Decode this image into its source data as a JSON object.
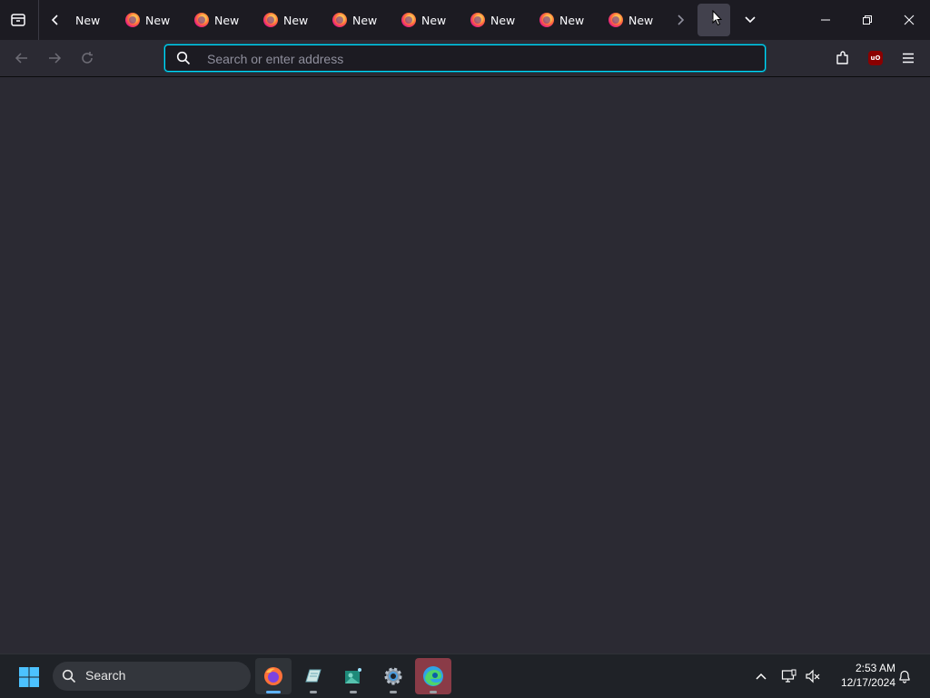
{
  "tabbar": {
    "tabs": [
      {
        "label": "New"
      },
      {
        "label": "New"
      },
      {
        "label": "New"
      },
      {
        "label": "New"
      },
      {
        "label": "New"
      },
      {
        "label": "New"
      },
      {
        "label": "New"
      },
      {
        "label": "New"
      },
      {
        "label": "New"
      }
    ],
    "new_tab_label": "-",
    "icons": {
      "tab_list": "firefox-view-icon",
      "scroll_left": "chevron-left-icon",
      "scroll_right": "chevron-right-icon",
      "all_tabs": "chevron-down-icon",
      "minimize": "minimize-icon",
      "restore": "restore-icon",
      "close": "close-icon"
    }
  },
  "navbar": {
    "address": {
      "value": "",
      "placeholder": "Search or enter address"
    },
    "extensions": [
      {
        "name": "extensions-icon"
      },
      {
        "name": "ublock-origin-icon",
        "text": "uO"
      }
    ],
    "menu_icon": "hamburger-menu-icon"
  },
  "taskbar": {
    "search_label": "Search",
    "apps": [
      {
        "name": "firefox",
        "active": true
      },
      {
        "name": "notes-app"
      },
      {
        "name": "image-app"
      },
      {
        "name": "settings"
      },
      {
        "name": "edge"
      }
    ],
    "tray": {
      "time": "2:53 AM",
      "date": "12/17/2024"
    }
  },
  "colors": {
    "accent": "#00ddff",
    "tabbar_bg": "#1c1b22",
    "content_bg": "#2b2a33",
    "taskbar_bg": "#1f2227"
  }
}
